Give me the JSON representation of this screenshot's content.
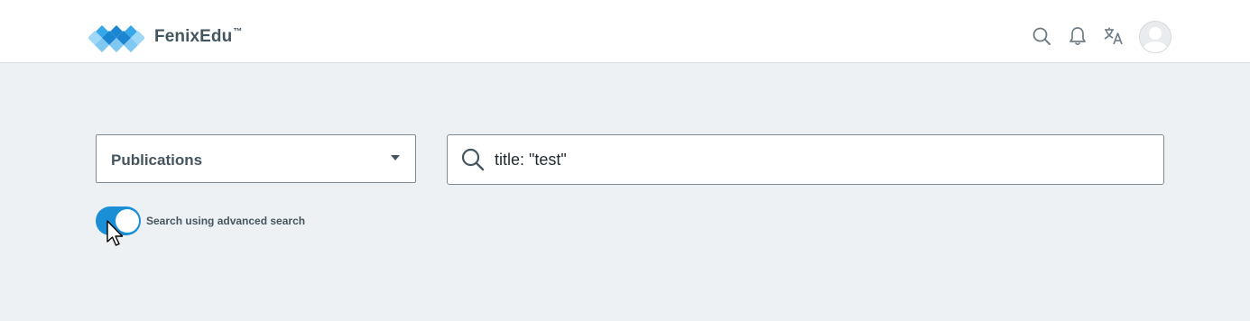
{
  "header": {
    "brand_name": "FenixEdu",
    "brand_trademark": "™",
    "icons": [
      "search-icon",
      "bell-icon",
      "translate-icon",
      "avatar"
    ]
  },
  "search_form": {
    "category_select": {
      "selected": "Publications"
    },
    "query": {
      "value": "title: \"test\""
    },
    "advanced_toggle": {
      "enabled": true,
      "label": "Search using advanced search"
    }
  },
  "colors": {
    "accent": "#1a8fd6",
    "logo_light": "#7ec8f2",
    "logo_mid": "#36a8ea",
    "logo_dark": "#1a85d0",
    "page_background": "#eef1f4",
    "text": "#45555f"
  }
}
